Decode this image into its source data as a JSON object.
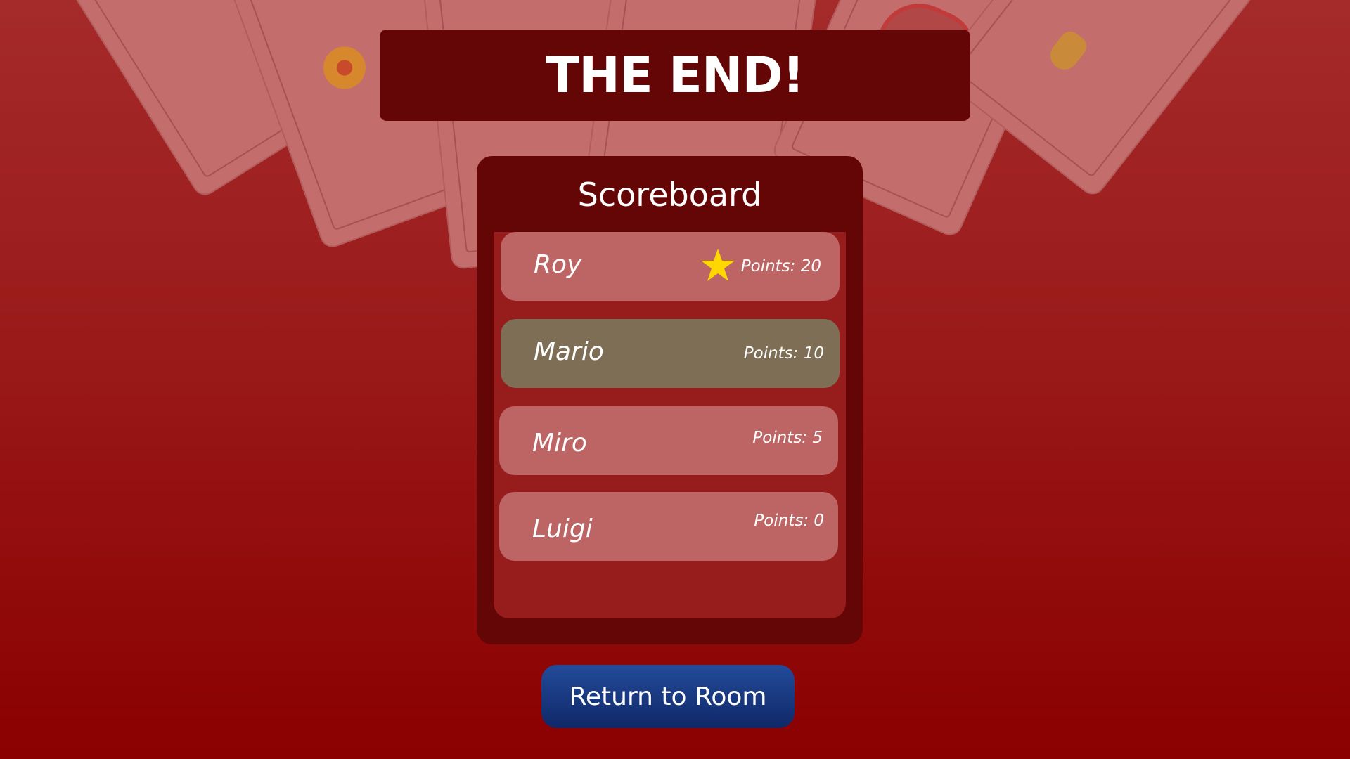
{
  "title": "THE END!",
  "scoreboard": {
    "title": "Scoreboard",
    "players": [
      {
        "name": "Roy",
        "points": "Points: 20",
        "winner": true
      },
      {
        "name": "Mario",
        "points": "Points: 10",
        "highlighted": true
      },
      {
        "name": "Miro",
        "points": "Points: 5"
      },
      {
        "name": "Luigi",
        "points": "Points: 0"
      }
    ]
  },
  "actions": {
    "return_label": "Return to Room"
  },
  "colors": {
    "background_top": "#a52a2a",
    "background_bottom": "#8b0000",
    "panel": "#650606",
    "row": "#bd6464",
    "row_highlight": "#7d6e55",
    "star": "#ffd700",
    "button": "#1a3a80"
  },
  "icons": {
    "winner": "star-icon"
  }
}
